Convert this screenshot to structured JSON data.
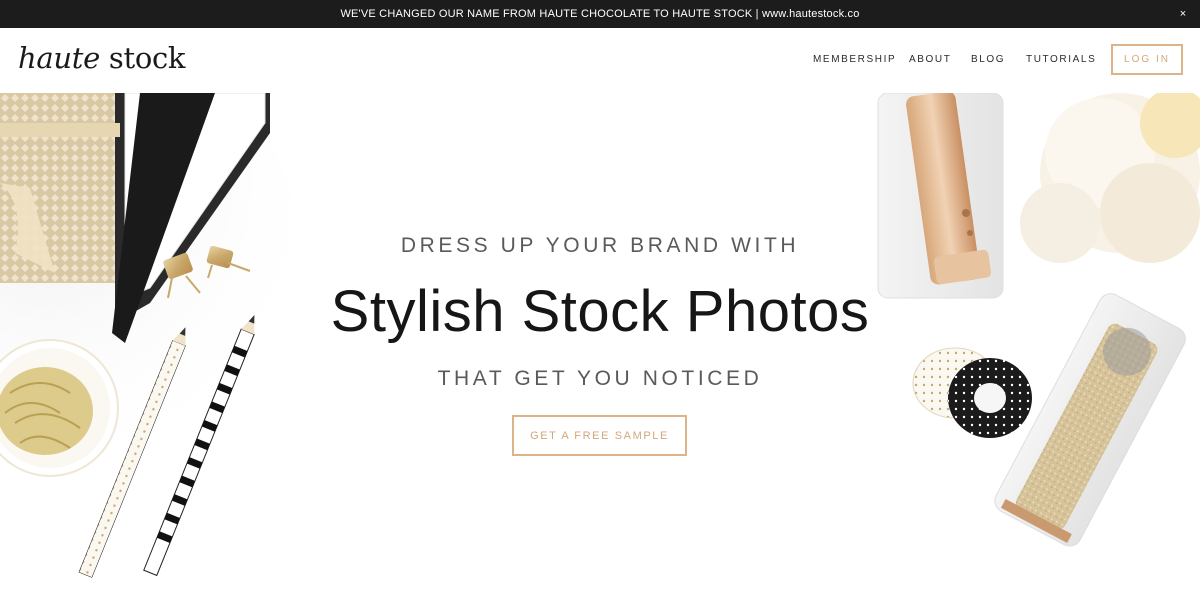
{
  "announcement": {
    "text": "WE'VE CHANGED OUR NAME FROM HAUTE CHOCOLATE TO HAUTE STOCK | www.hautestock.co",
    "close_symbol": "×"
  },
  "header": {
    "logo_part1": "haute",
    "logo_part2": " stock",
    "nav": [
      {
        "label": "MEMBERSHIP"
      },
      {
        "label": "ABOUT"
      },
      {
        "label": "BLOG"
      },
      {
        "label": "TUTORIALS"
      }
    ],
    "login_label": "LOG IN"
  },
  "hero": {
    "line1": "DRESS UP YOUR BRAND WITH",
    "line2": "Stylish Stock Photos",
    "line3": "THAT GET YOU NOTICED",
    "cta_label": "GET A FREE SAMPLE"
  },
  "theme": {
    "accent": "#d2a77a",
    "dark": "#1c1c1c",
    "text": "#161616"
  },
  "icons": {
    "close": "close-icon"
  }
}
